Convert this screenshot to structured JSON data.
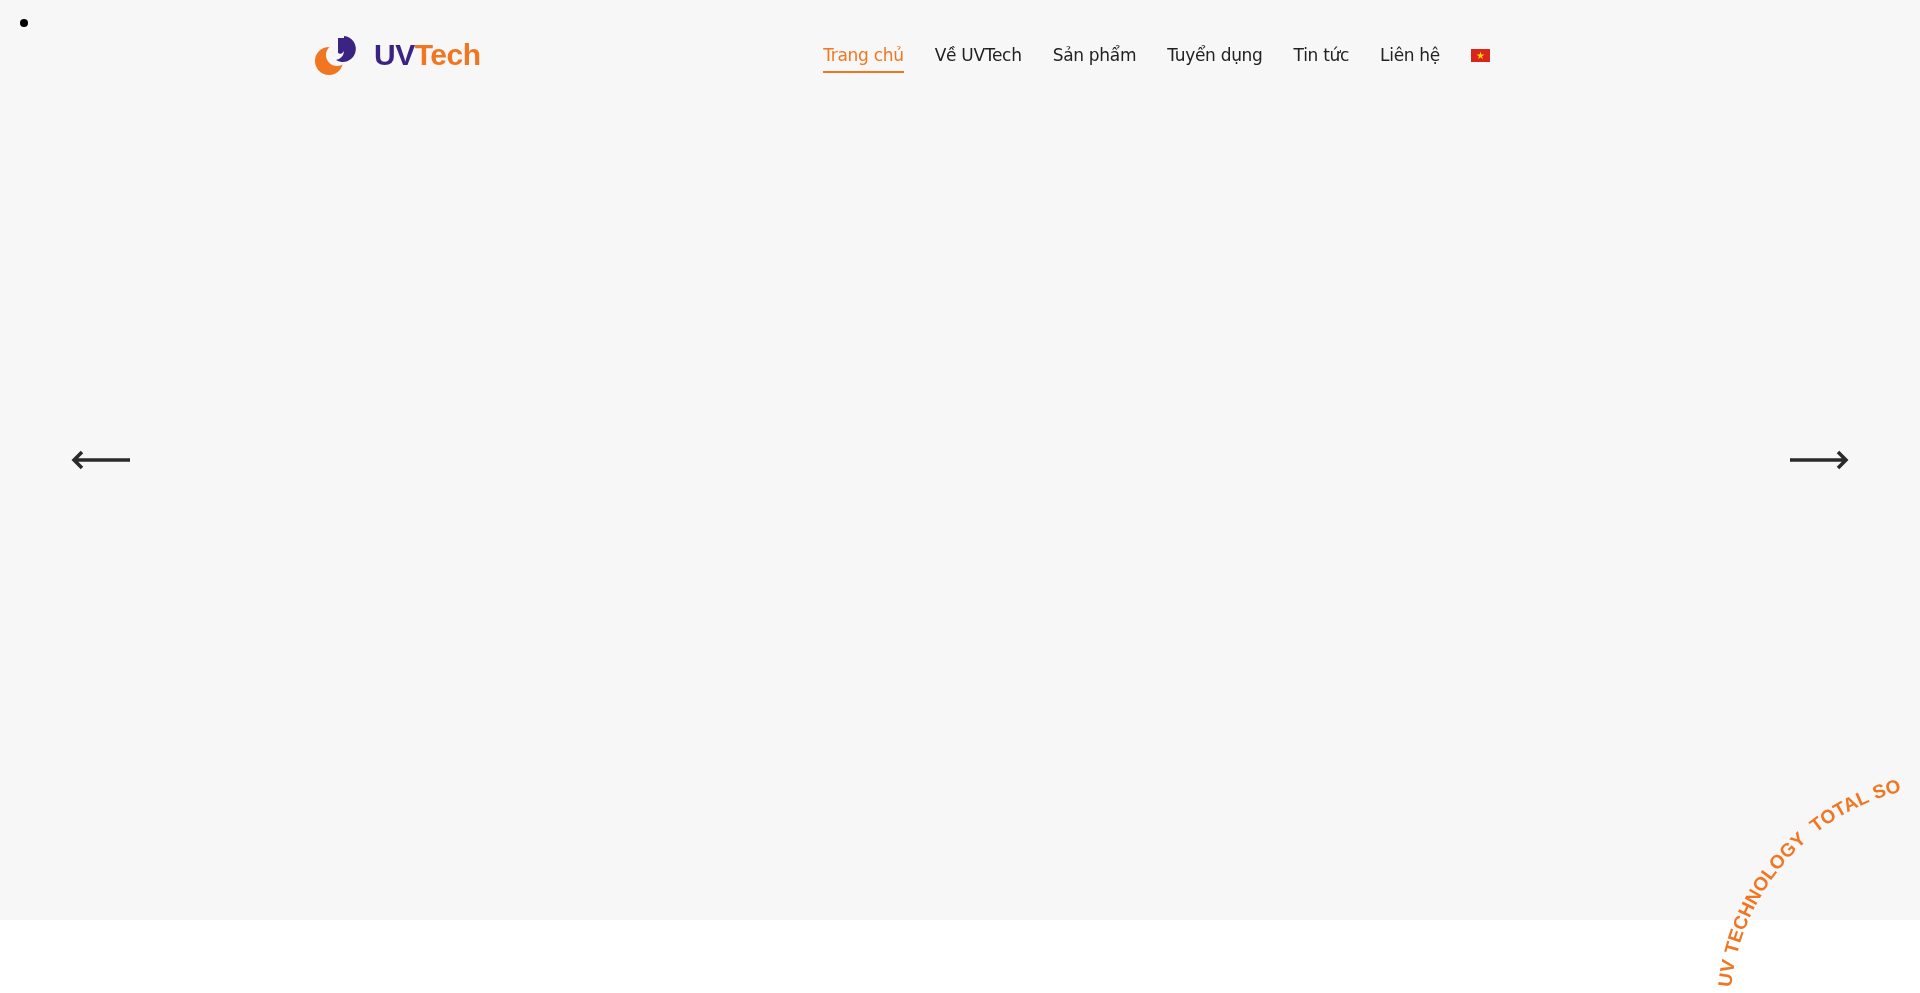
{
  "logo": {
    "part_1": "UV",
    "part_2": "Tech"
  },
  "nav": {
    "items": [
      {
        "label": "Trang chủ",
        "selected": true
      },
      {
        "label": "Về UVTech",
        "selected": false
      },
      {
        "label": "Sản phẩm",
        "selected": false
      },
      {
        "label": "Tuyển dụng",
        "selected": false
      },
      {
        "label": "Tin tức",
        "selected": false
      },
      {
        "label": "Liên hệ",
        "selected": false
      }
    ]
  },
  "circular_badge": {
    "segments": [
      "UV TECHNOLOGY",
      "TOTAL SO"
    ]
  }
}
